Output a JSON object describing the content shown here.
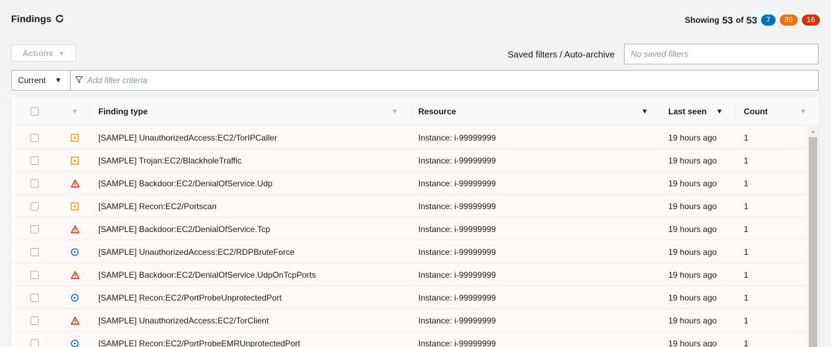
{
  "header": {
    "title": "Findings",
    "showing_label": "Showing",
    "showing_count": "53",
    "of_label": "of",
    "total_count": "53",
    "badges": [
      {
        "value": "7",
        "color": "#0073bb"
      },
      {
        "value": "30",
        "color": "#ec7211"
      },
      {
        "value": "16",
        "color": "#d13212"
      }
    ]
  },
  "toolbar": {
    "actions_label": "Actions",
    "saved_filters_label": "Saved filters / Auto-archive",
    "saved_filters_placeholder": "No saved filters"
  },
  "filter": {
    "scope_value": "Current",
    "placeholder": "Add filter criteria"
  },
  "table": {
    "columns": {
      "finding_type": "Finding type",
      "resource": "Resource",
      "last_seen": "Last seen",
      "count": "Count"
    },
    "rows": [
      {
        "severity": "medium",
        "finding_type": "[SAMPLE] UnauthorizedAccess:EC2/TorIPCaller",
        "resource": "Instance: i-99999999",
        "last_seen": "19 hours ago",
        "count": "1"
      },
      {
        "severity": "medium",
        "finding_type": "[SAMPLE] Trojan:EC2/BlackholeTraffic",
        "resource": "Instance: i-99999999",
        "last_seen": "19 hours ago",
        "count": "1"
      },
      {
        "severity": "high",
        "finding_type": "[SAMPLE] Backdoor:EC2/DenialOfService.Udp",
        "resource": "Instance: i-99999999",
        "last_seen": "19 hours ago",
        "count": "1"
      },
      {
        "severity": "medium",
        "finding_type": "[SAMPLE] Recon:EC2/Portscan",
        "resource": "Instance: i-99999999",
        "last_seen": "19 hours ago",
        "count": "1"
      },
      {
        "severity": "high",
        "finding_type": "[SAMPLE] Backdoor:EC2/DenialOfService.Tcp",
        "resource": "Instance: i-99999999",
        "last_seen": "19 hours ago",
        "count": "1"
      },
      {
        "severity": "low",
        "finding_type": "[SAMPLE] UnauthorizedAccess:EC2/RDPBruteForce",
        "resource": "Instance: i-99999999",
        "last_seen": "19 hours ago",
        "count": "1"
      },
      {
        "severity": "high",
        "finding_type": "[SAMPLE] Backdoor:EC2/DenialOfService.UdpOnTcpPorts",
        "resource": "Instance: i-99999999",
        "last_seen": "19 hours ago",
        "count": "1"
      },
      {
        "severity": "low",
        "finding_type": "[SAMPLE] Recon:EC2/PortProbeUnprotectedPort",
        "resource": "Instance: i-99999999",
        "last_seen": "19 hours ago",
        "count": "1"
      },
      {
        "severity": "high",
        "finding_type": "[SAMPLE] UnauthorizedAccess:EC2/TorClient",
        "resource": "Instance: i-99999999",
        "last_seen": "19 hours ago",
        "count": "1"
      },
      {
        "severity": "low",
        "finding_type": "[SAMPLE] Recon:EC2/PortProbeEMRUnprotectedPort",
        "resource": "Instance: i-99999999",
        "last_seen": "19 hours ago",
        "count": "1"
      }
    ]
  },
  "icons": {
    "refresh": "refresh-icon",
    "filter": "filter-funnel-icon",
    "severity_low": "low-severity-circle-icon",
    "severity_medium": "medium-severity-square-icon",
    "severity_high": "high-severity-triangle-icon"
  },
  "severity_colors": {
    "low": "#0073bb",
    "medium": "#ec9a11",
    "high": "#d13212"
  }
}
